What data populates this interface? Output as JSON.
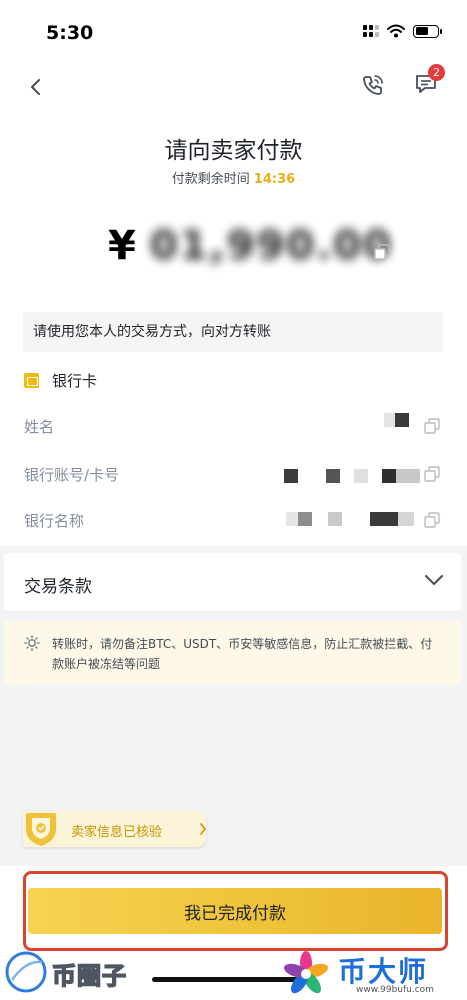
{
  "status_bar": {
    "time": "5:30"
  },
  "header": {
    "unread_count": "2",
    "title": "请向卖家付款",
    "countdown_label": "付款剩余时间",
    "countdown_value": "14:36"
  },
  "amount": {
    "currency_symbol": "¥",
    "value_obscured": "¥1,990.00"
  },
  "notice": "请使用您本人的交易方式，向对方转账",
  "payment_method": {
    "icon": "bank-card-icon",
    "label": "银行卡"
  },
  "fields": [
    {
      "label": "姓名"
    },
    {
      "label": "银行账号/卡号"
    },
    {
      "label": "银行名称"
    }
  ],
  "terms": {
    "label": "交易条款"
  },
  "warning": {
    "text": "转账时，请勿备注BTC、USDT、币安等敏感信息，防止汇款被拦截、付款账户被冻结等问题"
  },
  "verified_badge": {
    "label": "卖家信息已核验"
  },
  "actions": {
    "complete_label": "我已完成付款"
  },
  "watermarks": {
    "left": "币圈子",
    "right": "币大师",
    "right_url": "www.99bufu.com"
  },
  "colors": {
    "accent_yellow": "#F0B90B",
    "countdown": "#E9B016",
    "badge_red": "#E33B3B",
    "highlight_frame": "#D8452E",
    "watermark_blue": "#1E6FD9"
  }
}
